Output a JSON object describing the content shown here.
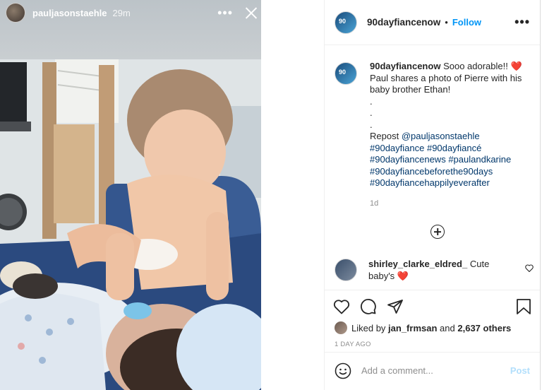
{
  "story": {
    "username": "pauljasonstaehle",
    "time": "29m",
    "more_icon": "more-horizontal-icon",
    "close_icon": "close-icon"
  },
  "post": {
    "header": {
      "username": "90dayfiancenow",
      "separator": "•",
      "follow_label": "Follow",
      "more_icon": "more-horizontal-icon"
    },
    "caption": {
      "username": "90dayfiancenow",
      "text_first": "Sooo adorable!!",
      "emoji": "❤️",
      "lines": [
        "Paul shares a photo of Pierre with his",
        "baby brother Ethan!",
        ".",
        ".",
        "."
      ],
      "repost_label": "Repost",
      "repost_link": "@pauljasonstaehle",
      "hashtags": [
        "#90dayfiance",
        "#90dayfiancé",
        "#90dayfiancenews",
        "#paulandkarine",
        "#90dayfiancebeforethe90days",
        "#90dayfiancehappilyeverafter"
      ],
      "time": "1d"
    },
    "comment": {
      "username": "shirley_clarke_eldred_",
      "text": "Cute",
      "text2": "baby's",
      "emoji": "❤️"
    },
    "likes": {
      "prefix": "Liked by",
      "user": "jan_frmsan",
      "and": "and",
      "others": "2,637 others"
    },
    "date": "1 DAY AGO",
    "add_comment": {
      "placeholder": "Add a comment...",
      "post_label": "Post"
    }
  },
  "colors": {
    "link": "#00376b",
    "follow": "#0095f6",
    "muted": "#8e8e8e",
    "heart": "#ed4956",
    "post_disabled": "#b2dffc"
  }
}
